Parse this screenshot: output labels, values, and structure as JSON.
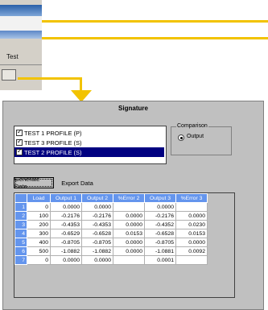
{
  "fragment": {
    "label": "Test"
  },
  "dialog": {
    "title": "Signature",
    "profiles": [
      {
        "label": "TEST 1 PROFILE (P)",
        "checked": true,
        "selected": false
      },
      {
        "label": "TEST 3 PROFILE (S)",
        "checked": true,
        "selected": false
      },
      {
        "label": "TEST 2 PROFILE (S)",
        "checked": true,
        "selected": true
      }
    ],
    "comparison": {
      "legend": "Comparison",
      "option": "Output"
    },
    "buttons": {
      "generate": "Generate Data",
      "export": "Export Data"
    },
    "table": {
      "columns": [
        "",
        "Load",
        "Output 1",
        "Output 2",
        "%Error 2",
        "Output 3",
        "%Error 3"
      ],
      "rows": [
        [
          "1",
          "0",
          "0.0000",
          "0.0000",
          "",
          "0.0000",
          ""
        ],
        [
          "2",
          "100",
          "-0.2176",
          "-0.2176",
          "0.0000",
          "-0.2176",
          "0.0000"
        ],
        [
          "3",
          "200",
          "-0.4353",
          "-0.4353",
          "0.0000",
          "-0.4352",
          "0.0230"
        ],
        [
          "4",
          "300",
          "-0.6529",
          "-0.6528",
          "0.0153",
          "-0.6528",
          "0.0153"
        ],
        [
          "5",
          "400",
          "-0.8705",
          "-0.8705",
          "0.0000",
          "-0.8705",
          "0.0000"
        ],
        [
          "6",
          "500",
          "-1.0882",
          "-1.0882",
          "0.0000",
          "-1.0881",
          "0.0092"
        ],
        [
          "7",
          "0",
          "0.0000",
          "0.0000",
          "",
          "0.0001",
          ""
        ]
      ]
    }
  },
  "colors": {
    "callout": "#f2c300",
    "selection": "#000080",
    "grid_header": "#6495ed"
  }
}
